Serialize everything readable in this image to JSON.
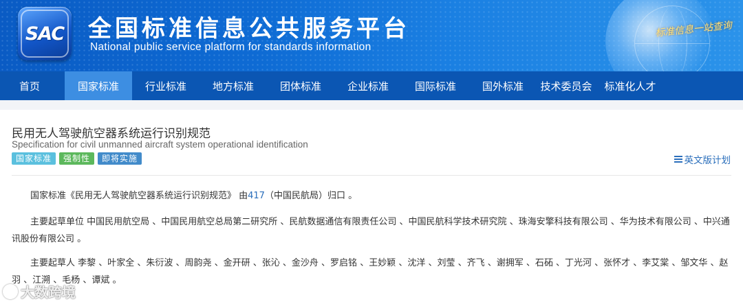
{
  "header": {
    "logo_text": "SAC",
    "title": "全国标准信息公共服务平台",
    "subtitle": "National public service platform  for standards information",
    "slogan": "标准信息一站查询",
    "brand_color": "#0b56b3"
  },
  "nav": {
    "items": [
      {
        "label": "首页",
        "active": false
      },
      {
        "label": "国家标准",
        "active": true
      },
      {
        "label": "行业标准",
        "active": false
      },
      {
        "label": "地方标准",
        "active": false
      },
      {
        "label": "团体标准",
        "active": false
      },
      {
        "label": "企业标准",
        "active": false
      },
      {
        "label": "国际标准",
        "active": false
      },
      {
        "label": "国外标准",
        "active": false
      },
      {
        "label": "技术委员会",
        "active": false
      },
      {
        "label": "标准化人才",
        "active": false
      }
    ]
  },
  "standard": {
    "title_cn": "民用无人驾驶航空器系统运行识别规范",
    "title_en": "Specification for civil unmanned aircraft system operational identification",
    "tags": [
      "国家标准",
      "强制性",
      "即将实施"
    ],
    "english_plan_label": "英文版计划",
    "intro_prefix": "国家标准《民用无人驾驶航空器系统运行识别规范》 由",
    "intro_link": "417",
    "intro_suffix": "（中国民航局）归口 。",
    "drafting_units": "主要起草单位 中国民用航空局 、中国民用航空总局第二研究所 、民航数据通信有限责任公司 、中国民航科学技术研究院 、珠海安擎科技有限公司 、华为技术有限公司 、中兴通讯股份有限公司 。",
    "drafters": "主要起草人 李黎 、叶家全 、朱衍波 、周韵尧 、金开研 、张沁 、金沙舟 、罗启铭 、王妙颖 、沈洋 、刘莹 、齐飞 、谢拥军 、石砳 、丁光河 、张怀才 、李艾棠 、邹文华 、赵羽 、江溯 、毛杨 、谭斌 。"
  },
  "watermark": {
    "text": "大数跨境"
  }
}
